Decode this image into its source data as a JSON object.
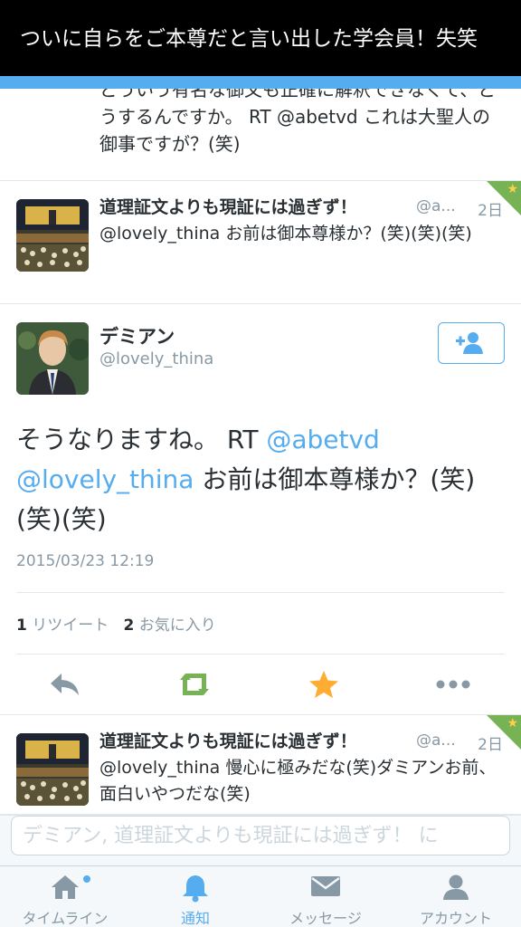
{
  "caption": "ついに自らをご本尊だと言い出した学会員！失笑",
  "prev_tweet": {
    "text": "どういう有名な御文も正確に解釈できなくて、どうするんですか。 RT @abetvd これは大聖人の御事ですが？(笑)"
  },
  "tweets": [
    {
      "name": "道理証文よりも現証には過ぎず！",
      "handle": "@a...",
      "time": "2日",
      "text": "@lovely_thina お前は御本尊様か？(笑)(笑)(笑)"
    },
    {
      "name": "道理証文よりも現証には過ぎず！",
      "handle": "@a...",
      "time": "2日",
      "text": "@lovely_thina 慢心に極みだな(笑)ダミアンお前、面白いやつだな(笑)"
    }
  ],
  "detail": {
    "name": "デミアン",
    "handle": "@lovely_thina",
    "text_main": "そうなりますね。 RT ",
    "mention1": "@abetvd",
    "mention2": "@lovely_thina",
    "text_rest": " お前は御本尊様か？(笑)(笑)(笑)",
    "date": "2015/03/23 12:19",
    "retweet_count": "1",
    "retweet_label": "リツイート",
    "fav_count": "2",
    "fav_label": "お気に入り"
  },
  "reply_input": {
    "placeholder": "デミアン, 道理証文よりも現証には過ぎず！ に"
  },
  "tabs": [
    {
      "label": "タイムライン",
      "icon": "home-icon"
    },
    {
      "label": "通知",
      "icon": "bell-icon"
    },
    {
      "label": "メッセージ",
      "icon": "envelope-icon"
    },
    {
      "label": "アカウント",
      "icon": "person-icon"
    }
  ],
  "colors": {
    "accent": "#55acee",
    "favorite": "#ffac33",
    "retweet": "#77b255",
    "muted": "#8899a6"
  }
}
